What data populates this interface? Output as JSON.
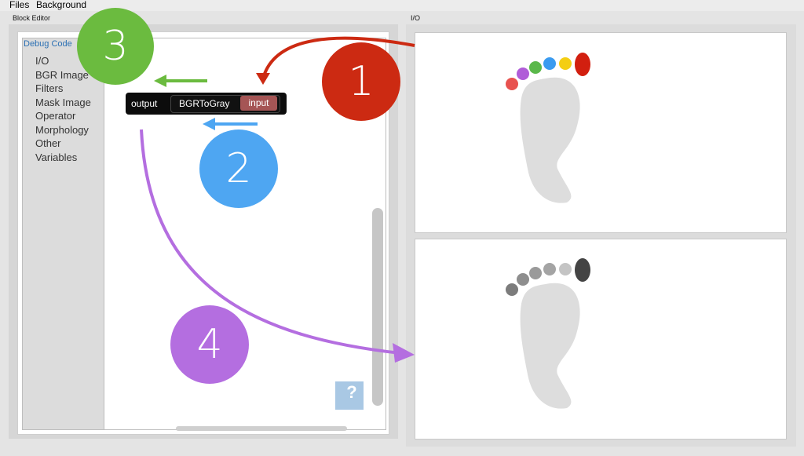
{
  "menu": {
    "files": "Files",
    "background": "Background"
  },
  "panels": {
    "block_editor": "Block Editor",
    "io": "I/O"
  },
  "toolbox": {
    "debug_code": "Debug Code",
    "items": [
      "I/O",
      "BGR Image",
      "Filters",
      "Mask Image",
      "Operator",
      "Morphology",
      "Other",
      "Variables"
    ]
  },
  "block": {
    "output_label": "output",
    "function_label": "BGRToGray",
    "input_label": "input"
  },
  "callouts": [
    {
      "number": "1",
      "color": "#cc2a12"
    },
    {
      "number": "2",
      "color": "#4ea6f2"
    },
    {
      "number": "3",
      "color": "#6bbb3f"
    },
    {
      "number": "4",
      "color": "#b46ee0"
    }
  ],
  "colors": {
    "arrow_red": "#cc2a12",
    "arrow_green": "#6bbb3f",
    "arrow_blue": "#4ea6f2",
    "arrow_purple": "#b46ee0",
    "foot": "#dddddd",
    "input_toes": [
      "#e8524f",
      "#b05cd8",
      "#5ab84a",
      "#3a9bf0",
      "#f4ce12",
      "#d21f0f"
    ],
    "output_toes": [
      "#7c7c7c",
      "#8e8e8e",
      "#9a9a9a",
      "#a4a4a4",
      "#c4c4c4",
      "#444444"
    ]
  },
  "icons": {
    "trash": "help-icon"
  }
}
